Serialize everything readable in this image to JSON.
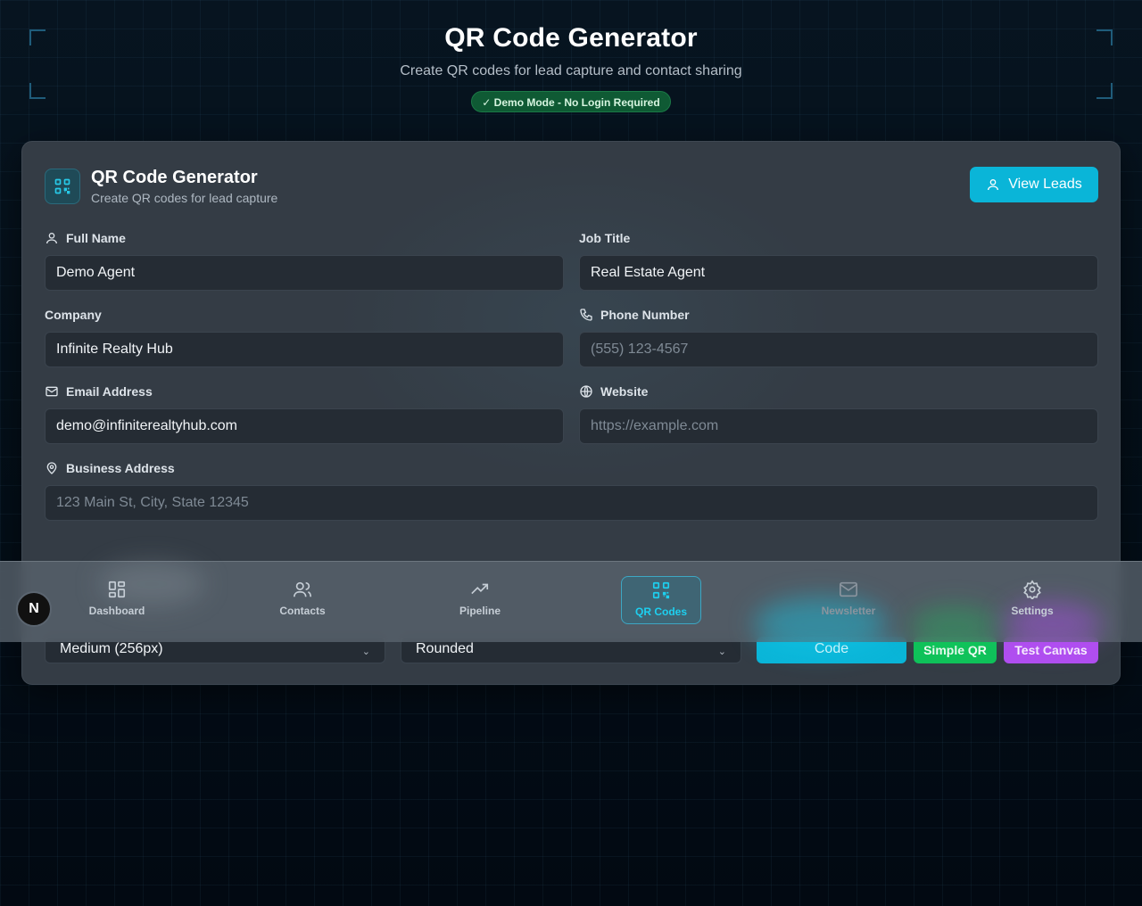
{
  "header": {
    "title": "QR Code Generator",
    "subtitle": "Create QR codes for lead capture and contact sharing",
    "badge": "✓ Demo Mode - No Login Required"
  },
  "card": {
    "title": "QR Code Generator",
    "subtitle": "Create QR codes for lead capture",
    "view_leads": "View Leads",
    "icon": "qr-code-icon"
  },
  "form": {
    "full_name": {
      "label": "Full Name",
      "value": "Demo Agent",
      "icon": "user-icon"
    },
    "job_title": {
      "label": "Job Title",
      "value": "Real Estate Agent"
    },
    "company": {
      "label": "Company",
      "value": "Infinite Realty Hub"
    },
    "phone": {
      "label": "Phone Number",
      "placeholder": "(555) 123-4567",
      "icon": "phone-icon"
    },
    "email": {
      "label": "Email Address",
      "value": "demo@infiniterealtyhub.com",
      "icon": "mail-icon"
    },
    "website": {
      "label": "Website",
      "placeholder": "https://example.com",
      "icon": "globe-icon"
    },
    "address": {
      "label": "Business Address",
      "placeholder": "123 Main St, City, State 12345",
      "icon": "map-pin-icon"
    }
  },
  "controls": {
    "size_select": "Medium (256px)",
    "style_select": "Rounded",
    "generate_button": "Code",
    "simple_qr_button": "Simple QR",
    "test_canvas_button": "Test Canvas"
  },
  "nav": {
    "badge": "N",
    "items": [
      {
        "label": "Dashboard",
        "icon": "grid-icon"
      },
      {
        "label": "Contacts",
        "icon": "users-icon"
      },
      {
        "label": "Pipeline",
        "icon": "trending-up-icon"
      },
      {
        "label": "QR Codes",
        "icon": "qr-code-icon"
      },
      {
        "label": "Newsletter",
        "icon": "mail-icon"
      },
      {
        "label": "Settings",
        "icon": "gear-icon"
      }
    ]
  },
  "colors": {
    "accent": "#0ab5d8",
    "green": "#0fc25a",
    "purple": "#b04ef0",
    "card": "#343c45"
  }
}
